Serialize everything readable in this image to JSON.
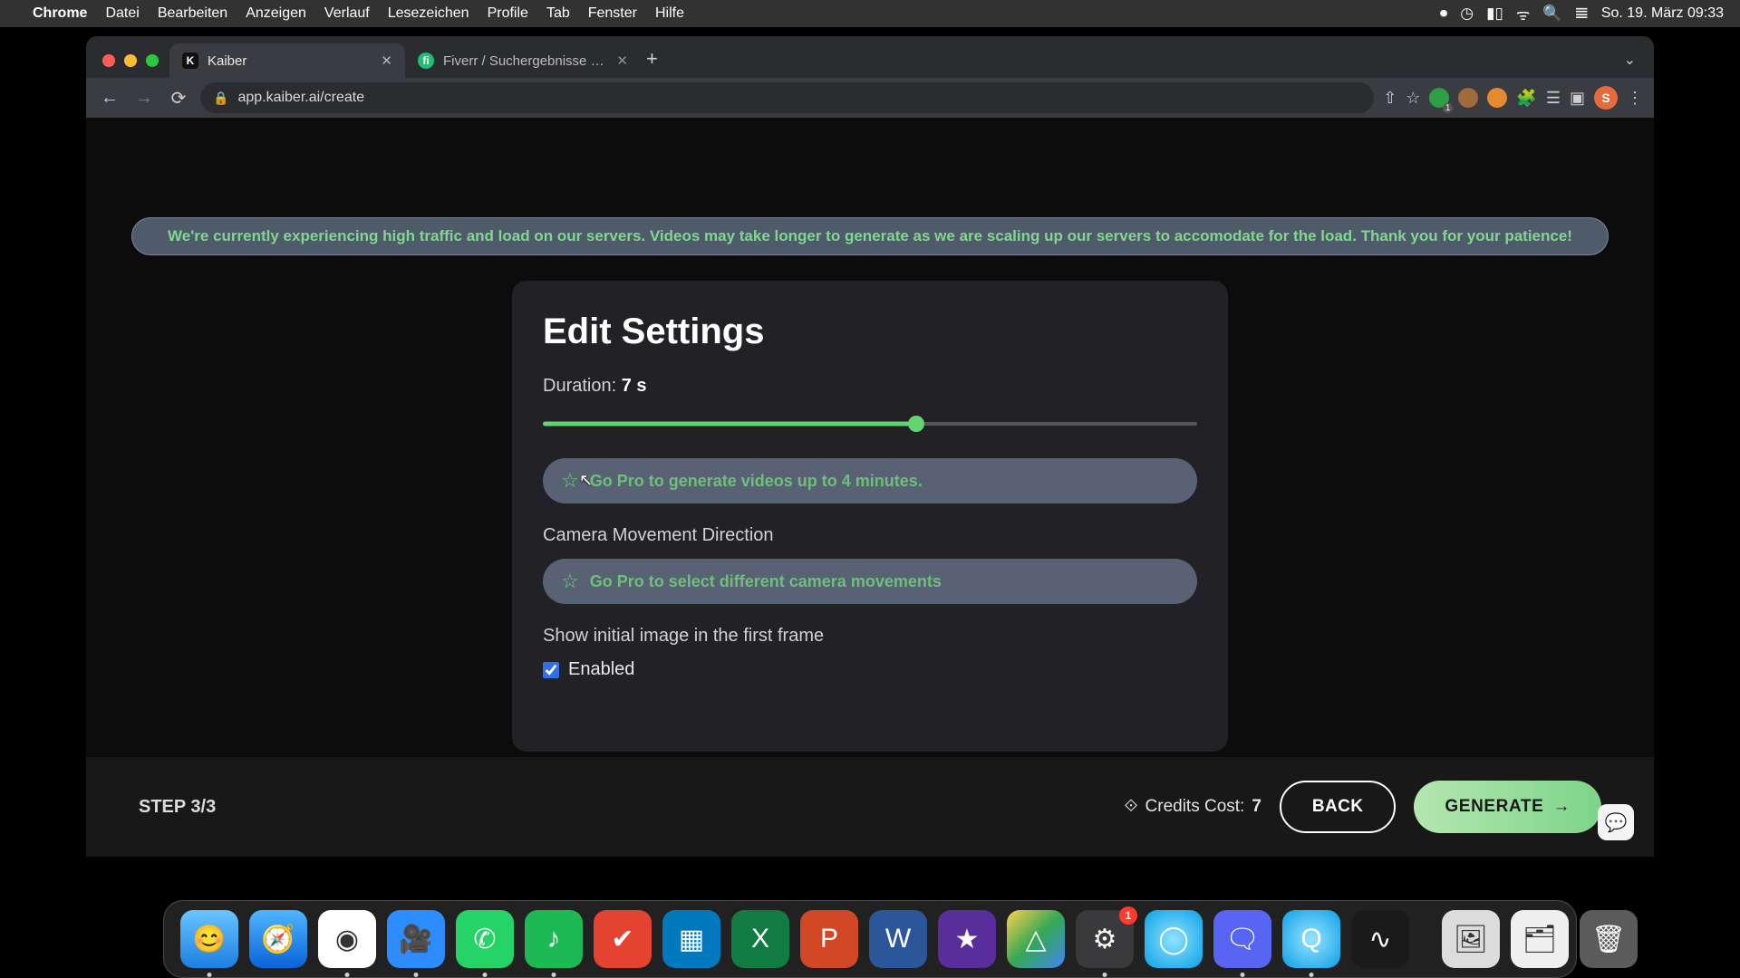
{
  "menubar": {
    "app": "Chrome",
    "items": [
      "Datei",
      "Bearbeiten",
      "Anzeigen",
      "Verlauf",
      "Lesezeichen",
      "Profile",
      "Tab",
      "Fenster",
      "Hilfe"
    ],
    "datetime": "So. 19. März  09:33"
  },
  "tabstrip": {
    "tab1": {
      "title": "Kaiber"
    },
    "tab2": {
      "title": "Fiverr / Suchergebnisse für „lo"
    },
    "new": "+",
    "overflow_glyph": "⌄"
  },
  "toolbar": {
    "url": "app.kaiber.ai/create",
    "avatar_initial": "S",
    "ext_badge": "1"
  },
  "banner": "We're currently experiencing high traffic and load on our servers. Videos may take longer to generate as we are scaling up our servers to accomodate for the load. Thank you for your patience!",
  "panel": {
    "heading": "Edit Settings",
    "duration_label": "Duration: ",
    "duration_value": "7 s",
    "pro_duration": "Go Pro to generate videos up to 4 minutes.",
    "camera_heading": "Camera Movement Direction",
    "pro_camera": "Go Pro to select different camera movements",
    "show_initial": "Show initial image in the first frame",
    "enabled_label": "Enabled",
    "slider_percent": 57
  },
  "footer": {
    "step": "STEP 3/3",
    "credits_label": "Credits Cost: ",
    "credits_value": "7",
    "back": "BACK",
    "generate": "GENERATE"
  },
  "dock": {
    "settings_badge": "1"
  }
}
